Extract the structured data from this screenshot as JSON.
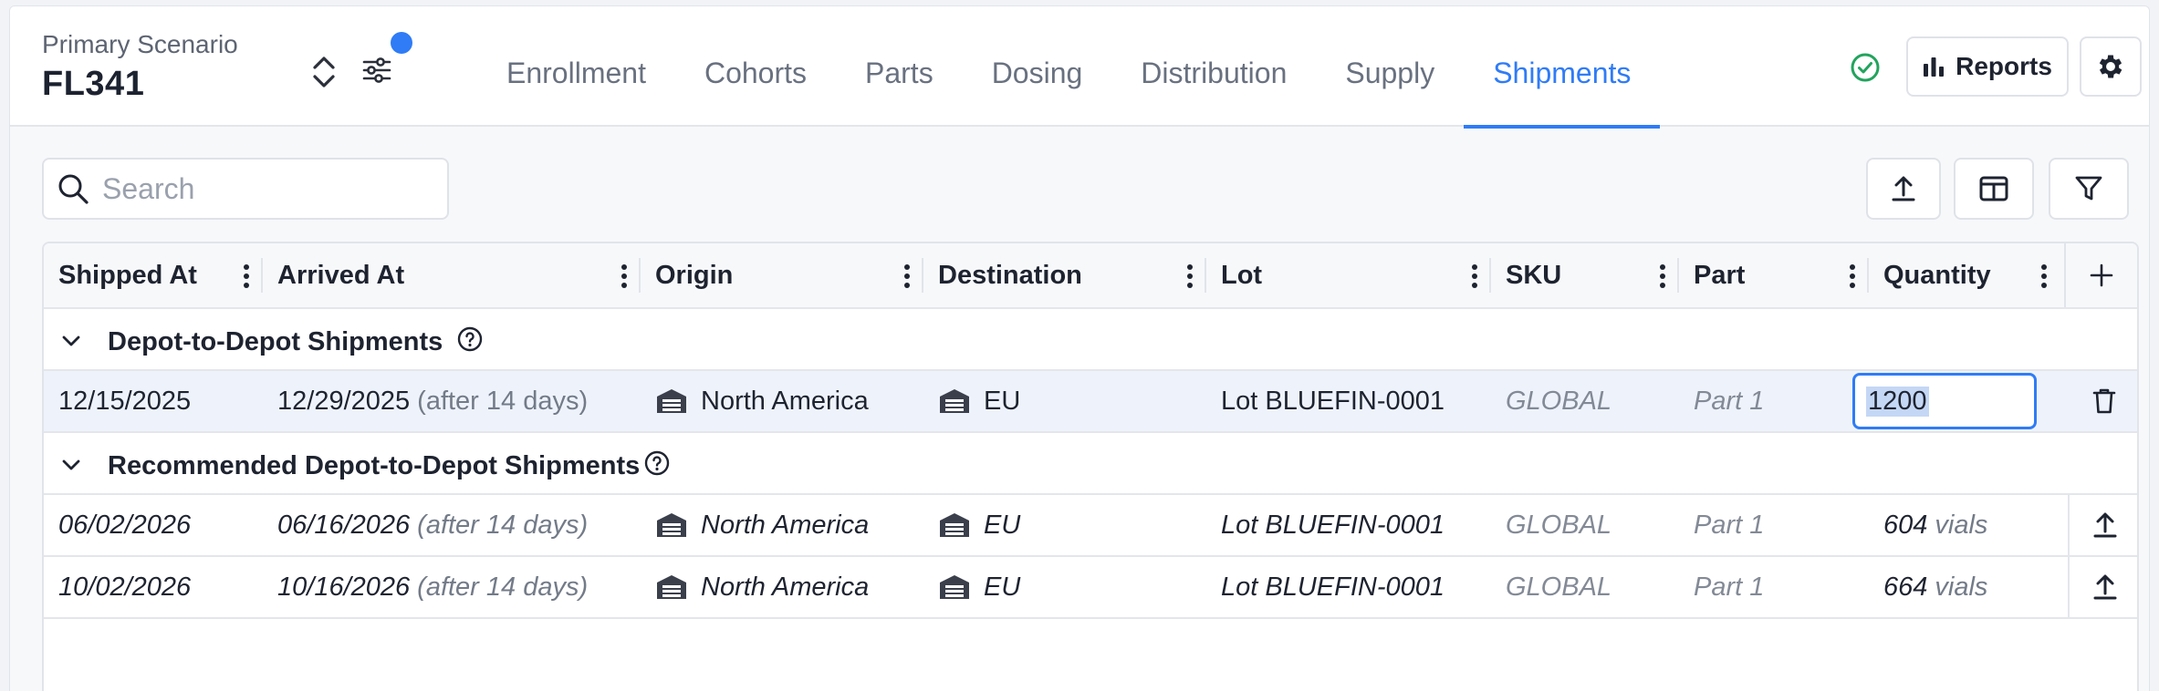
{
  "header": {
    "scenario_label": "Primary Scenario",
    "scenario_name": "FL341",
    "tabs": [
      {
        "label": "Enrollment"
      },
      {
        "label": "Cohorts"
      },
      {
        "label": "Parts"
      },
      {
        "label": "Dosing"
      },
      {
        "label": "Distribution"
      },
      {
        "label": "Supply"
      },
      {
        "label": "Shipments"
      }
    ],
    "active_tab": "Shipments",
    "reports_label": "Reports",
    "accent_color": "#2f7cf6",
    "status_color": "#22a45d"
  },
  "toolbar": {
    "search_placeholder": "Search"
  },
  "table": {
    "columns": [
      "Shipped At",
      "Arrived At",
      "Origin",
      "Destination",
      "Lot",
      "SKU",
      "Part",
      "Quantity"
    ],
    "groups": [
      {
        "label": "Depot-to-Depot Shipments",
        "rows": [
          {
            "shipped_at": "12/15/2025",
            "arrived_at": "12/29/2025",
            "arrived_note": "(after 14 days)",
            "origin": "North America",
            "destination": "EU",
            "lot": "Lot BLUEFIN-0001",
            "sku": "GLOBAL",
            "part": "Part 1",
            "quantity": "1200"
          }
        ]
      },
      {
        "label": "Recommended Depot-to-Depot Shipments",
        "rows": [
          {
            "shipped_at": "06/02/2026",
            "arrived_at": "06/16/2026",
            "arrived_note": "(after 14 days)",
            "origin": "North America",
            "destination": "EU",
            "lot": "Lot BLUEFIN-0001",
            "sku": "GLOBAL",
            "part": "Part 1",
            "quantity": "604",
            "unit": "vials"
          },
          {
            "shipped_at": "10/02/2026",
            "arrived_at": "10/16/2026",
            "arrived_note": "(after 14 days)",
            "origin": "North America",
            "destination": "EU",
            "lot": "Lot BLUEFIN-0001",
            "sku": "GLOBAL",
            "part": "Part 1",
            "quantity": "664",
            "unit": "vials"
          }
        ]
      }
    ]
  }
}
